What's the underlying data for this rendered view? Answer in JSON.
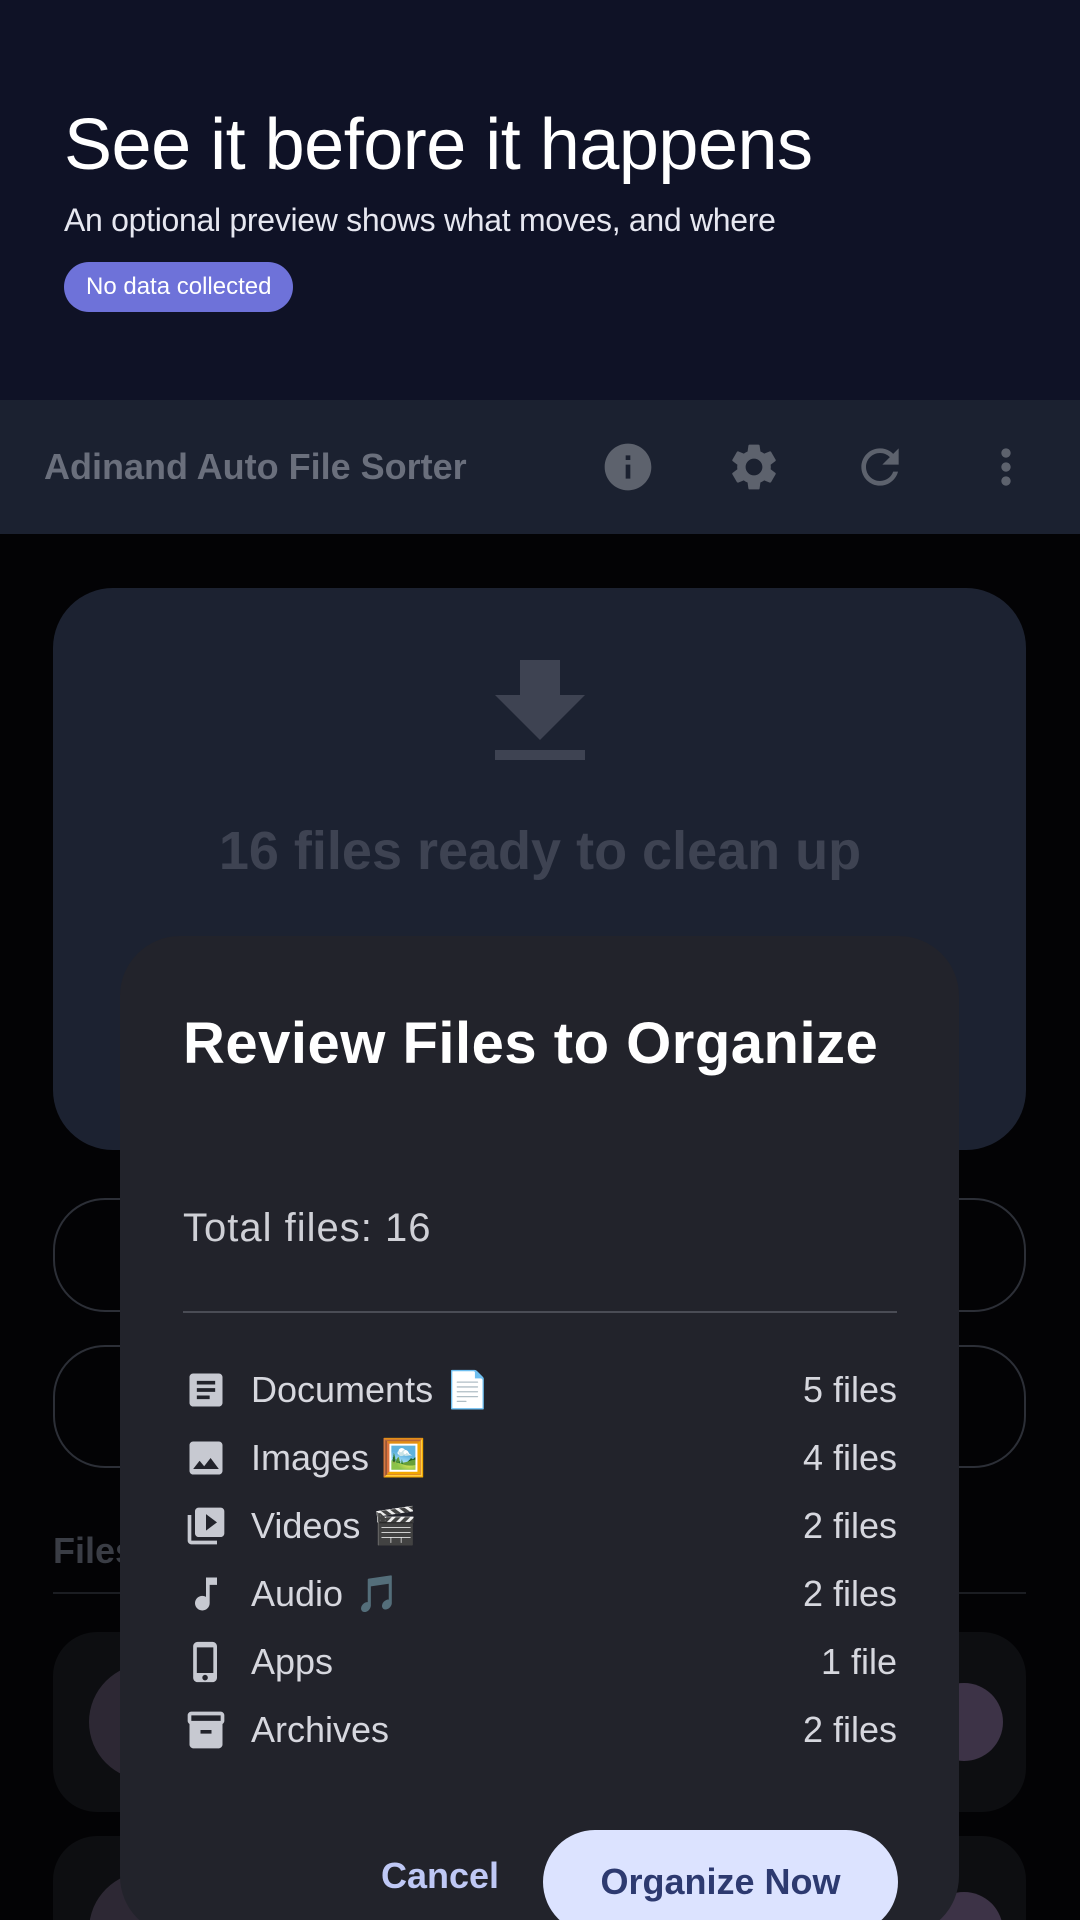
{
  "promo": {
    "title": "See it before it happens",
    "subtitle": "An optional preview shows what moves, and where",
    "badge": "No data collected",
    "colors": {
      "background": "#0f1226",
      "badge": "#6e72d9"
    }
  },
  "appbar": {
    "title": "Adinand Auto File Sorter",
    "actions": [
      "info-icon",
      "gear-icon",
      "refresh-icon",
      "more-vert-icon"
    ]
  },
  "hero": {
    "icon": "download-icon",
    "text": "16 files ready to clean up"
  },
  "section": {
    "label": "Files"
  },
  "dialog": {
    "title": "Review Files to Organize",
    "total": "Total files: 16",
    "categories": [
      {
        "icon": "document-icon",
        "name": "Documents",
        "emoji": "📄",
        "count": "5 files"
      },
      {
        "icon": "image-icon",
        "name": "Images",
        "emoji": "🖼️",
        "count": "4 files"
      },
      {
        "icon": "video-library-icon",
        "name": "Videos",
        "emoji": "🎬",
        "count": "2 files"
      },
      {
        "icon": "music-note-icon",
        "name": "Audio",
        "emoji": "🎵",
        "count": "2 files"
      },
      {
        "icon": "phone-icon",
        "name": "Apps",
        "emoji": "",
        "count": "1 file"
      },
      {
        "icon": "archive-icon",
        "name": "Archives",
        "emoji": "",
        "count": "2 files"
      }
    ],
    "cancel_label": "Cancel",
    "confirm_label": "Organize Now",
    "colors": {
      "surface": "#22232b",
      "primary": "#dce3ff"
    }
  }
}
